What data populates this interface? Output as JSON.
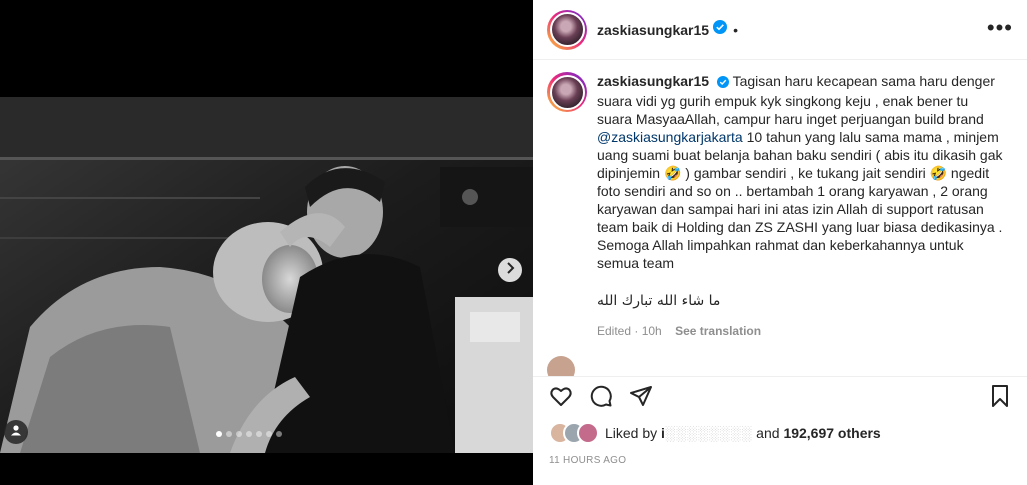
{
  "post": {
    "username": "zaskiasungkar15",
    "dot": "•",
    "more": "•••",
    "caption_parts": {
      "p1": "Tagisan haru kecapean sama haru denger suara vidi yg gurih empuk kyk singkong keju , enak bener tu suara MasyaaAllah, campur haru inget perjuangan build brand ",
      "mention": "@zaskiasungkarjakarta",
      "p2": " 10 tahun yang lalu sama mama , minjem uang suami buat belanja bahan baku sendiri ( abis itu dikasih gak dipinjemin ",
      "emoji1": "🤣",
      "p3": " ) gambar sendiri , ke tukang jait sendiri ",
      "emoji2": "🤣",
      "p4": " ngedit foto sendiri and so on .. bertambah 1 orang karyawan , 2 orang karyawan dan sampai hari ini atas izin Allah di support ratusan team baik di Holding dan ZS ZASHI yang luar biasa dedikasinya . Semoga Allah limpahkan rahmat dan keberkahannya untuk semua team"
    },
    "arabic_line": "ما شاء الله تبارك الله",
    "edited": "Edited · 10h",
    "see_translation": "See translation",
    "likes": {
      "prefix": "Liked by ",
      "blurred_name": "i",
      "middle": " and ",
      "count": "192,697 others"
    },
    "time": "11 HOURS AGO"
  },
  "carousel": {
    "dot_count": 7,
    "active_index": 0
  },
  "icons": {
    "verified": "verified-badge-icon",
    "like": "heart-icon",
    "comment": "comment-icon",
    "share": "share-icon",
    "save": "bookmark-icon",
    "next": "chevron-right-icon",
    "tag": "tagged-user-icon"
  },
  "colors": {
    "verified": "#0095f6",
    "mention": "#00376b",
    "muted": "#8e8e8e",
    "text": "#262626"
  }
}
